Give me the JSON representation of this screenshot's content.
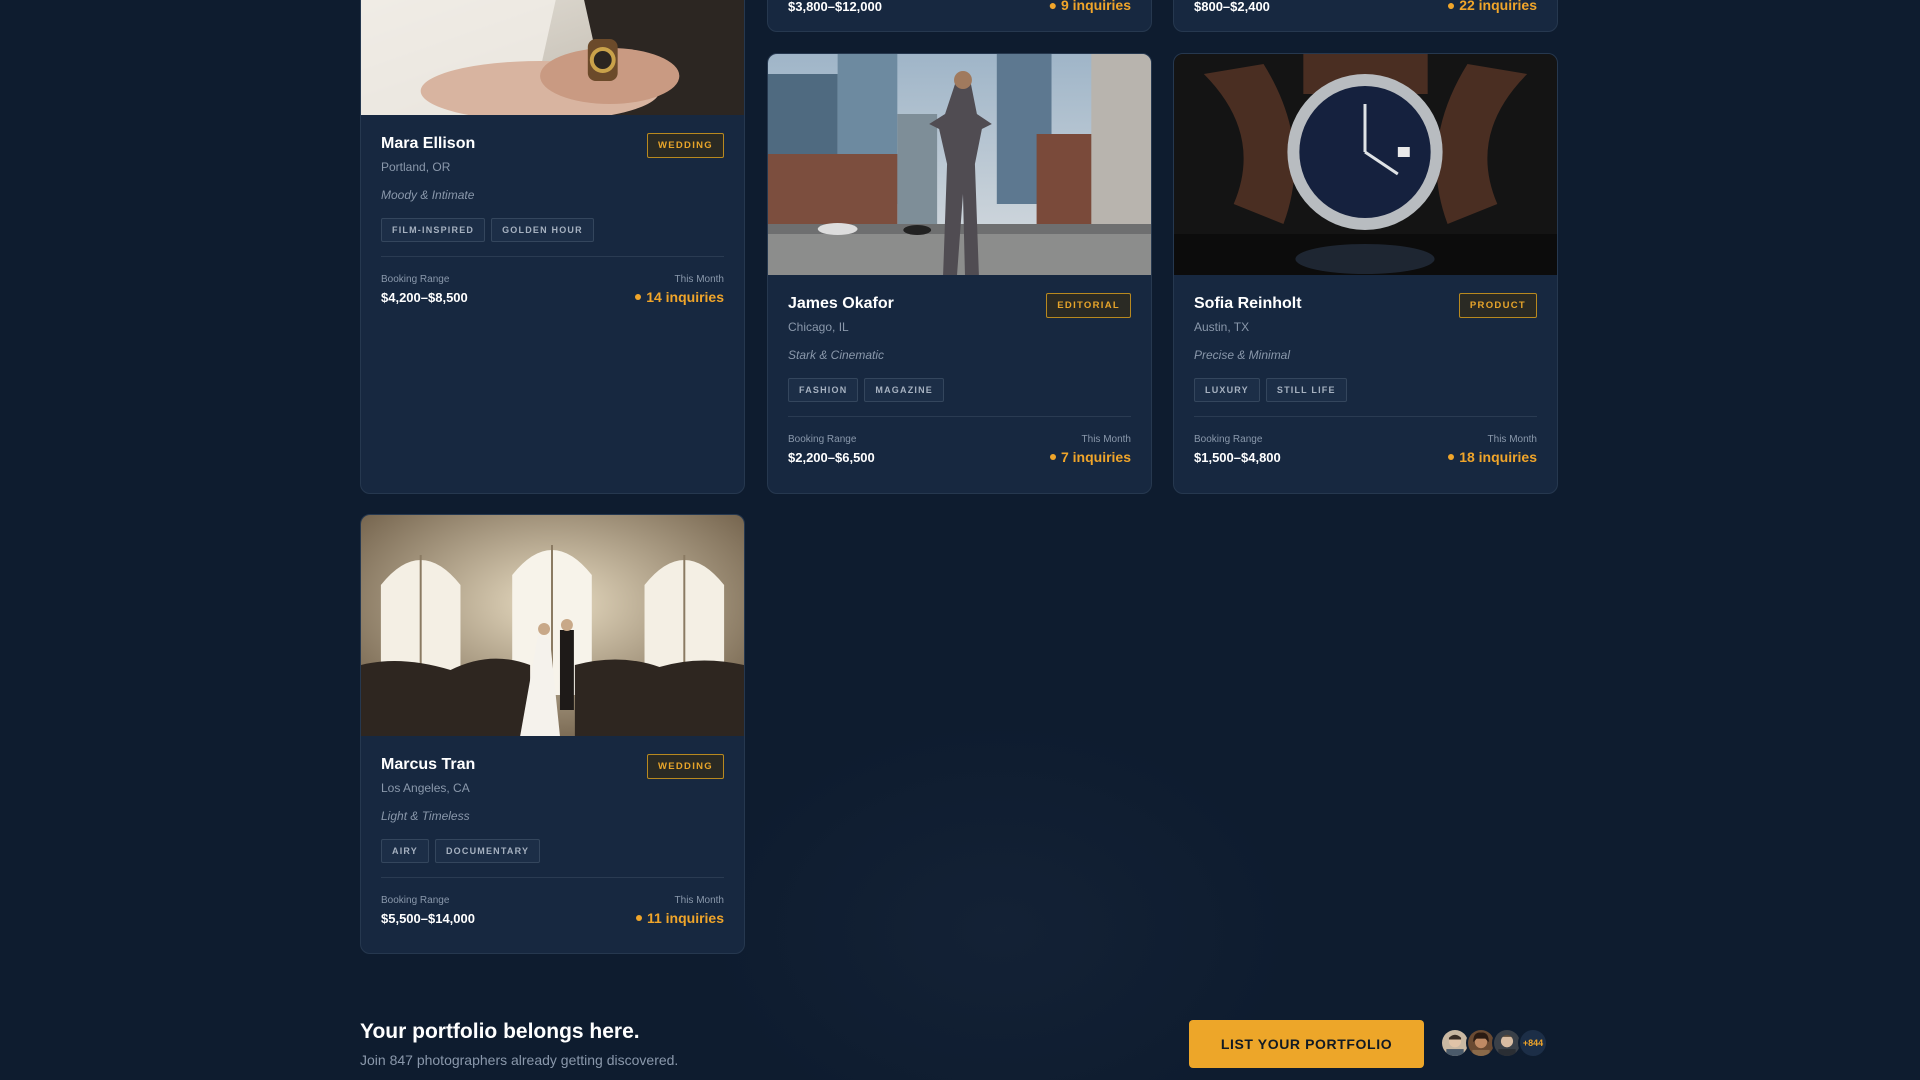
{
  "top_fragments": [
    {
      "price": "$3,800–$12,000",
      "inquiries": "9 inquiries"
    },
    {
      "price": "$800–$2,400",
      "inquiries": "22 inquiries"
    }
  ],
  "cards": [
    {
      "name": "Mara Ellison",
      "location": "Portland, OR",
      "style": "Moody & Intimate",
      "category": "WEDDING",
      "tags": [
        "FILM-INSPIRED",
        "GOLDEN HOUR"
      ],
      "booking_label": "Booking Range",
      "booking": "$4,200–$8,500",
      "month_label": "This Month",
      "inquiries": "14 inquiries"
    },
    {
      "name": "James Okafor",
      "location": "Chicago, IL",
      "style": "Stark & Cinematic",
      "category": "EDITORIAL",
      "tags": [
        "FASHION",
        "MAGAZINE"
      ],
      "booking_label": "Booking Range",
      "booking": "$2,200–$6,500",
      "month_label": "This Month",
      "inquiries": "7 inquiries"
    },
    {
      "name": "Sofia Reinholt",
      "location": "Austin, TX",
      "style": "Precise & Minimal",
      "category": "PRODUCT",
      "tags": [
        "LUXURY",
        "STILL LIFE"
      ],
      "booking_label": "Booking Range",
      "booking": "$1,500–$4,800",
      "month_label": "This Month",
      "inquiries": "18 inquiries"
    },
    {
      "name": "Marcus Tran",
      "location": "Los Angeles, CA",
      "style": "Light & Timeless",
      "category": "WEDDING",
      "tags": [
        "AIRY",
        "DOCUMENTARY"
      ],
      "booking_label": "Booking Range",
      "booking": "$5,500–$14,000",
      "month_label": "This Month",
      "inquiries": "11 inquiries"
    }
  ],
  "cta": {
    "title": "Your portfolio belongs here.",
    "subtitle": "Join 847 photographers already getting discovered.",
    "button": "LIST YOUR PORTFOLIO",
    "avatar_count": "+844"
  },
  "colors": {
    "background": "#0e1c2f",
    "card": "#172840",
    "accent": "#eda629"
  }
}
